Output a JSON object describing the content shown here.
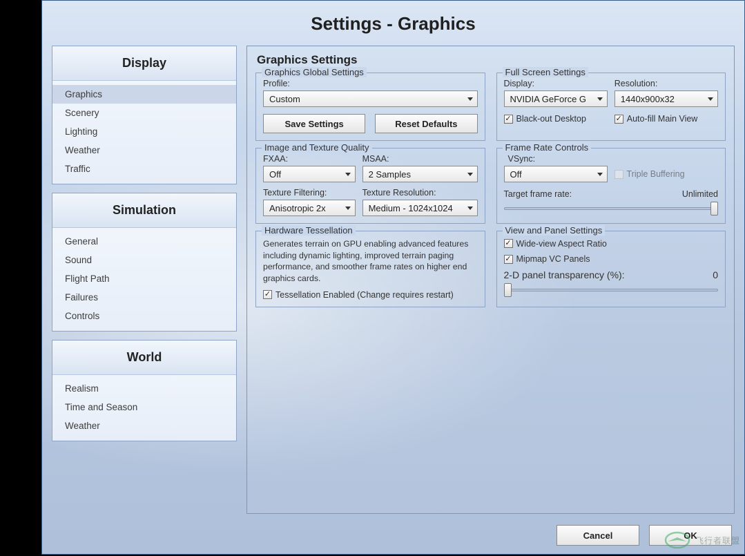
{
  "title": "Settings - Graphics",
  "sidebar": {
    "groups": [
      {
        "header": "Display",
        "items": [
          "Graphics",
          "Scenery",
          "Lighting",
          "Weather",
          "Traffic"
        ],
        "selected": 0
      },
      {
        "header": "Simulation",
        "items": [
          "General",
          "Sound",
          "Flight Path",
          "Failures",
          "Controls"
        ],
        "selected": -1
      },
      {
        "header": "World",
        "items": [
          "Realism",
          "Time and Season",
          "Weather"
        ],
        "selected": -1
      }
    ]
  },
  "main": {
    "heading": "Graphics Settings",
    "global": {
      "legend": "Graphics Global Settings",
      "profile_label": "Profile:",
      "profile_value": "Custom",
      "save_label": "Save Settings",
      "reset_label": "Reset Defaults"
    },
    "fullscreen": {
      "legend": "Full Screen Settings",
      "display_label": "Display:",
      "display_value": "NVIDIA GeForce G",
      "resolution_label": "Resolution:",
      "resolution_value": "1440x900x32",
      "blackout_label": "Black-out Desktop",
      "autofill_label": "Auto-fill Main View"
    },
    "texture": {
      "legend": "Image and Texture Quality",
      "fxaa_label": "FXAA:",
      "fxaa_value": "Off",
      "msaa_label": "MSAA:",
      "msaa_value": "2 Samples",
      "filter_label": "Texture Filtering:",
      "filter_value": "Anisotropic 2x",
      "res_label": "Texture Resolution:",
      "res_value": "Medium - 1024x1024"
    },
    "framerate": {
      "legend": "Frame Rate Controls",
      "vsync_label": "VSync:",
      "vsync_value": "Off",
      "triple_label": "Triple Buffering",
      "target_label": "Target frame rate:",
      "target_value": "Unlimited"
    },
    "tess": {
      "legend": "Hardware Tessellation",
      "desc": "Generates terrain on GPU enabling advanced features including dynamic lighting, improved terrain paging performance, and smoother frame rates on higher end graphics cards.",
      "enabled_label": "Tessellation Enabled (Change requires restart)"
    },
    "view": {
      "legend": "View and Panel Settings",
      "wide_label": "Wide-view Aspect Ratio",
      "mipmap_label": "Mipmap VC Panels",
      "transparency_label": "2-D panel transparency (%):",
      "transparency_value": "0"
    }
  },
  "footer": {
    "cancel": "Cancel",
    "ok": "OK"
  },
  "watermark": "飞行者联盟"
}
